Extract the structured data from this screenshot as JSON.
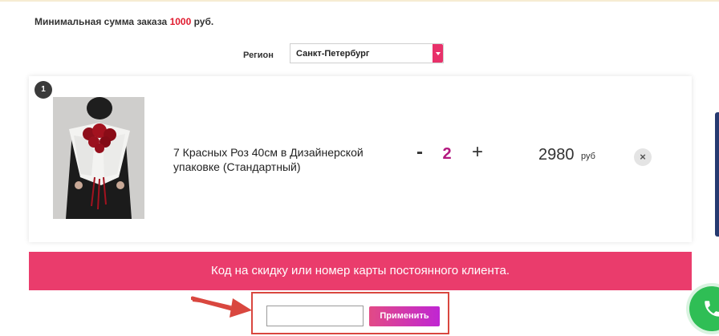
{
  "min_order": {
    "label": "Минимальная сумма заказа",
    "amount": "1000",
    "currency": "руб."
  },
  "region": {
    "label": "Регион",
    "selected": "Санкт-Петербург"
  },
  "cart": {
    "items": [
      {
        "index": "1",
        "name": "7 Красных Роз 40см в Дизайнерской упаковке (Стандартный)",
        "qty_minus": "-",
        "quantity": "2",
        "qty_plus": "+",
        "price": "2980",
        "currency": "руб",
        "remove": "×"
      }
    ]
  },
  "discount": {
    "banner_text": "Код на скидку или номер карты постоянного клиента.",
    "input_value": "",
    "input_placeholder": "",
    "apply_label": "Применить"
  },
  "icons": {
    "remove": "close-icon",
    "dropdown": "chevron-down-icon",
    "callout": "arrow-icon",
    "phone": "phone-icon"
  },
  "colors": {
    "accent": "#ea3c6c",
    "price_highlight": "#e0192d",
    "quantity": "#b3187f",
    "apply_gradient_start": "#e24a86",
    "apply_gradient_end": "#c026d3",
    "annotation": "#d9473f",
    "phone": "#2fbe55"
  }
}
